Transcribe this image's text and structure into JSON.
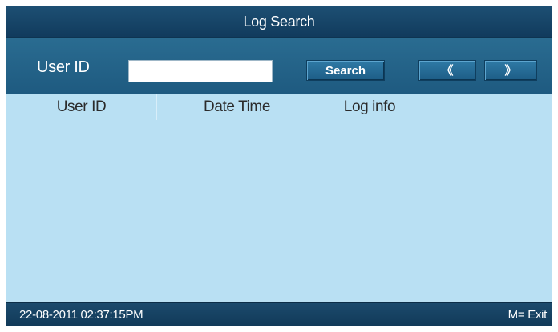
{
  "window": {
    "title": "Log Search"
  },
  "search": {
    "label": "User ID",
    "value": "",
    "search_button": "Search",
    "prev_icon": "double-chevron-left-icon",
    "next_icon": "double-chevron-right-icon",
    "prev_glyph": "《",
    "next_glyph": "》"
  },
  "table": {
    "columns": [
      "User ID",
      "Date Time",
      "Log info"
    ],
    "rows": []
  },
  "status": {
    "datetime": "22-08-2011  02:37:15PM",
    "exit_hint": "M= Exit"
  },
  "colors": {
    "title_bar": "#163f60",
    "toolbar": "#256488",
    "content_bg": "#b9e0f3",
    "status_bar": "#163f60"
  }
}
